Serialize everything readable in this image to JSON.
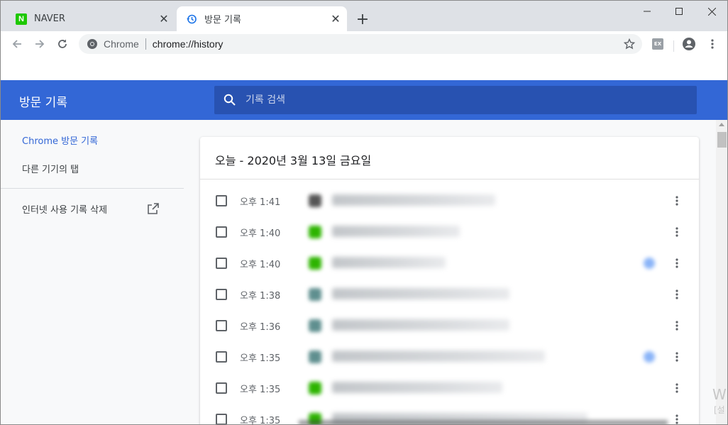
{
  "tabs": [
    {
      "title": "NAVER",
      "favicon": "naver-logo-icon",
      "active": false
    },
    {
      "title": "방문 기록",
      "favicon": "history-icon",
      "active": true
    }
  ],
  "toolbar": {
    "chip": "Chrome",
    "url": "chrome://history",
    "extension_label": "EX"
  },
  "app": {
    "title": "방문 기록",
    "search_placeholder": "기록 검색"
  },
  "sidebar": {
    "items": [
      {
        "label": "Chrome 방문 기록",
        "selected": true
      },
      {
        "label": "다른 기기의 탭",
        "selected": false
      },
      {
        "label": "인터넷 사용 기록 삭제",
        "selected": false
      }
    ]
  },
  "history": {
    "date_header": "오늘 - 2020년 3월 13일 금요일",
    "entries": [
      {
        "time": "오후 1:41",
        "favicon_color": "#555555",
        "starred": false
      },
      {
        "time": "오후 1:40",
        "favicon_color": "#2db400",
        "starred": false
      },
      {
        "time": "오후 1:40",
        "favicon_color": "#2db400",
        "starred": true
      },
      {
        "time": "오후 1:38",
        "favicon_color": "#5f8f8f",
        "starred": false
      },
      {
        "time": "오후 1:36",
        "favicon_color": "#5f8f8f",
        "starred": false
      },
      {
        "time": "오후 1:35",
        "favicon_color": "#5f8f8f",
        "starred": true
      },
      {
        "time": "오후 1:35",
        "favicon_color": "#2db400",
        "starred": false
      },
      {
        "time": "오후 1:35",
        "favicon_color": "#2db400",
        "starred": false
      }
    ]
  },
  "watermark": {
    "line1": "Wi",
    "line2": "[설"
  },
  "colors": {
    "header": "#3367d6",
    "search_bg": "#2852b1",
    "accent": "#3367d6"
  }
}
